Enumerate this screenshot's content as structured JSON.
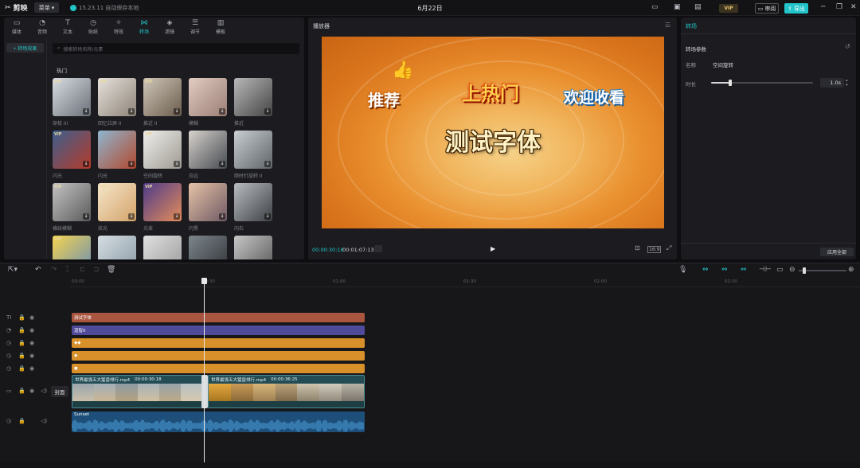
{
  "titlebar": {
    "app_name": "剪映",
    "menu_label": "菜单",
    "version_text": "15.23.11 自动保存本地",
    "date": "6月22日",
    "vip_label": "VIP",
    "review_label": "审阅",
    "export_label": "导出"
  },
  "media_tabs": [
    {
      "label": "媒体",
      "icon": "▭"
    },
    {
      "label": "音频",
      "icon": "◔"
    },
    {
      "label": "文本",
      "icon": "T"
    },
    {
      "label": "贴纸",
      "icon": "◷"
    },
    {
      "label": "特效",
      "icon": "✧"
    },
    {
      "label": "转场",
      "icon": "⋈"
    },
    {
      "label": "滤镜",
      "icon": "◈"
    },
    {
      "label": "调节",
      "icon": "☰"
    },
    {
      "label": "模板",
      "icon": "▥"
    }
  ],
  "active_tab": "转场",
  "sidebar": {
    "active_item": "• 转场效果"
  },
  "search": {
    "placeholder": "搜索转场名称/元素"
  },
  "section_title": "热门",
  "transitions": [
    {
      "label": "穿梭 III",
      "vip": true,
      "colors": [
        "#d9dde2",
        "#6a7078"
      ]
    },
    {
      "label": "回忆拉屏 II",
      "vip": true,
      "colors": [
        "#e6e2dc",
        "#8d8378"
      ]
    },
    {
      "label": "推近 II",
      "vip": true,
      "colors": [
        "#cfc6b8",
        "#6b5d4d"
      ]
    },
    {
      "label": "模糊",
      "vip": false,
      "colors": [
        "#e2ccc2",
        "#9a7e75"
      ]
    },
    {
      "label": "推近",
      "vip": false,
      "colors": [
        "#b8b8b8",
        "#444"
      ]
    },
    {
      "label": "闪光",
      "vip": true,
      "colors": [
        "#3c5f8e",
        "#b63b2a"
      ]
    },
    {
      "label": "闪光",
      "vip": false,
      "colors": [
        "#8fb5cf",
        "#b3492e"
      ]
    },
    {
      "label": "空间旋转",
      "vip": true,
      "colors": [
        "#f0efec",
        "#9e9a92"
      ]
    },
    {
      "label": "拉远",
      "vip": false,
      "colors": [
        "#d7d2cc",
        "#474b52"
      ]
    },
    {
      "label": "顺时针旋转 II",
      "vip": false,
      "colors": [
        "#c9ced2",
        "#5f6469"
      ]
    },
    {
      "label": "横线模糊",
      "vip": true,
      "colors": [
        "#c3c3c3",
        "#5b5b5b"
      ]
    },
    {
      "label": "炫光",
      "vip": true,
      "colors": [
        "#f5e6c9",
        "#d4a36a"
      ]
    },
    {
      "label": "光束",
      "vip": true,
      "colors": [
        "#4d3a8a",
        "#e58d59"
      ]
    },
    {
      "label": "闪黑",
      "vip": false,
      "colors": [
        "#e6c2a8",
        "#6f5a63"
      ]
    },
    {
      "label": "向右",
      "vip": false,
      "colors": [
        "#b8bcc0",
        "#3d4044"
      ]
    },
    {
      "label": "",
      "vip": true,
      "colors": [
        "#f4d34f",
        "#6a8fb5"
      ]
    },
    {
      "label": "",
      "vip": false,
      "colors": [
        "#d5dde2",
        "#8a9aa6"
      ]
    },
    {
      "label": "",
      "vip": false,
      "colors": [
        "#e0e0e0",
        "#9a9a9a"
      ]
    },
    {
      "label": "",
      "vip": false,
      "colors": [
        "#7e868c",
        "#2e3236"
      ]
    },
    {
      "label": "",
      "vip": false,
      "colors": [
        "#c7c7c7",
        "#555"
      ]
    }
  ],
  "player": {
    "title": "播放器",
    "canvas_text": "测试字体",
    "sticker_1": "推荐",
    "sticker_2": "上热门",
    "sticker_3": "欢迎收看",
    "current_time": "00:00:30:18",
    "total_time": "00:01:07:13",
    "ratio_label": "16:9"
  },
  "inspector": {
    "tab": "转场",
    "section": "转场参数",
    "name_label": "名称",
    "name_value": "空间旋转",
    "duration_label": "时长",
    "duration_value": "1.0s",
    "duration_fraction": 0.19,
    "apply_all": "应用全部"
  },
  "timeline": {
    "ruler": [
      "00:00",
      "00:30",
      "01:00",
      "01:30",
      "02:00",
      "02:30"
    ],
    "cover_label": "封面",
    "tracks": [
      {
        "type": "text",
        "icon": "TI",
        "label": "测试字体",
        "color": "#a9553f"
      },
      {
        "type": "sticker",
        "icon": "◔",
        "label": "道智II",
        "color": "#4f4a9a"
      },
      {
        "type": "sticker",
        "icon": "◷",
        "label": "◆◆",
        "color": "#d8902a"
      },
      {
        "type": "sticker",
        "icon": "◷",
        "label": "◆",
        "color": "#d8902a"
      },
      {
        "type": "sticker",
        "icon": "◷",
        "label": "◼",
        "color": "#d8902a"
      }
    ],
    "video_clip_1": {
      "name": "世界最强五大猛兽排行.mp4",
      "duration": "00:00:30:18"
    },
    "video_clip_2": {
      "name": "世界最强五大猛兽排行.mp4",
      "duration": "00:00:36:25"
    },
    "audio_clip": {
      "name": "Sunset"
    }
  }
}
